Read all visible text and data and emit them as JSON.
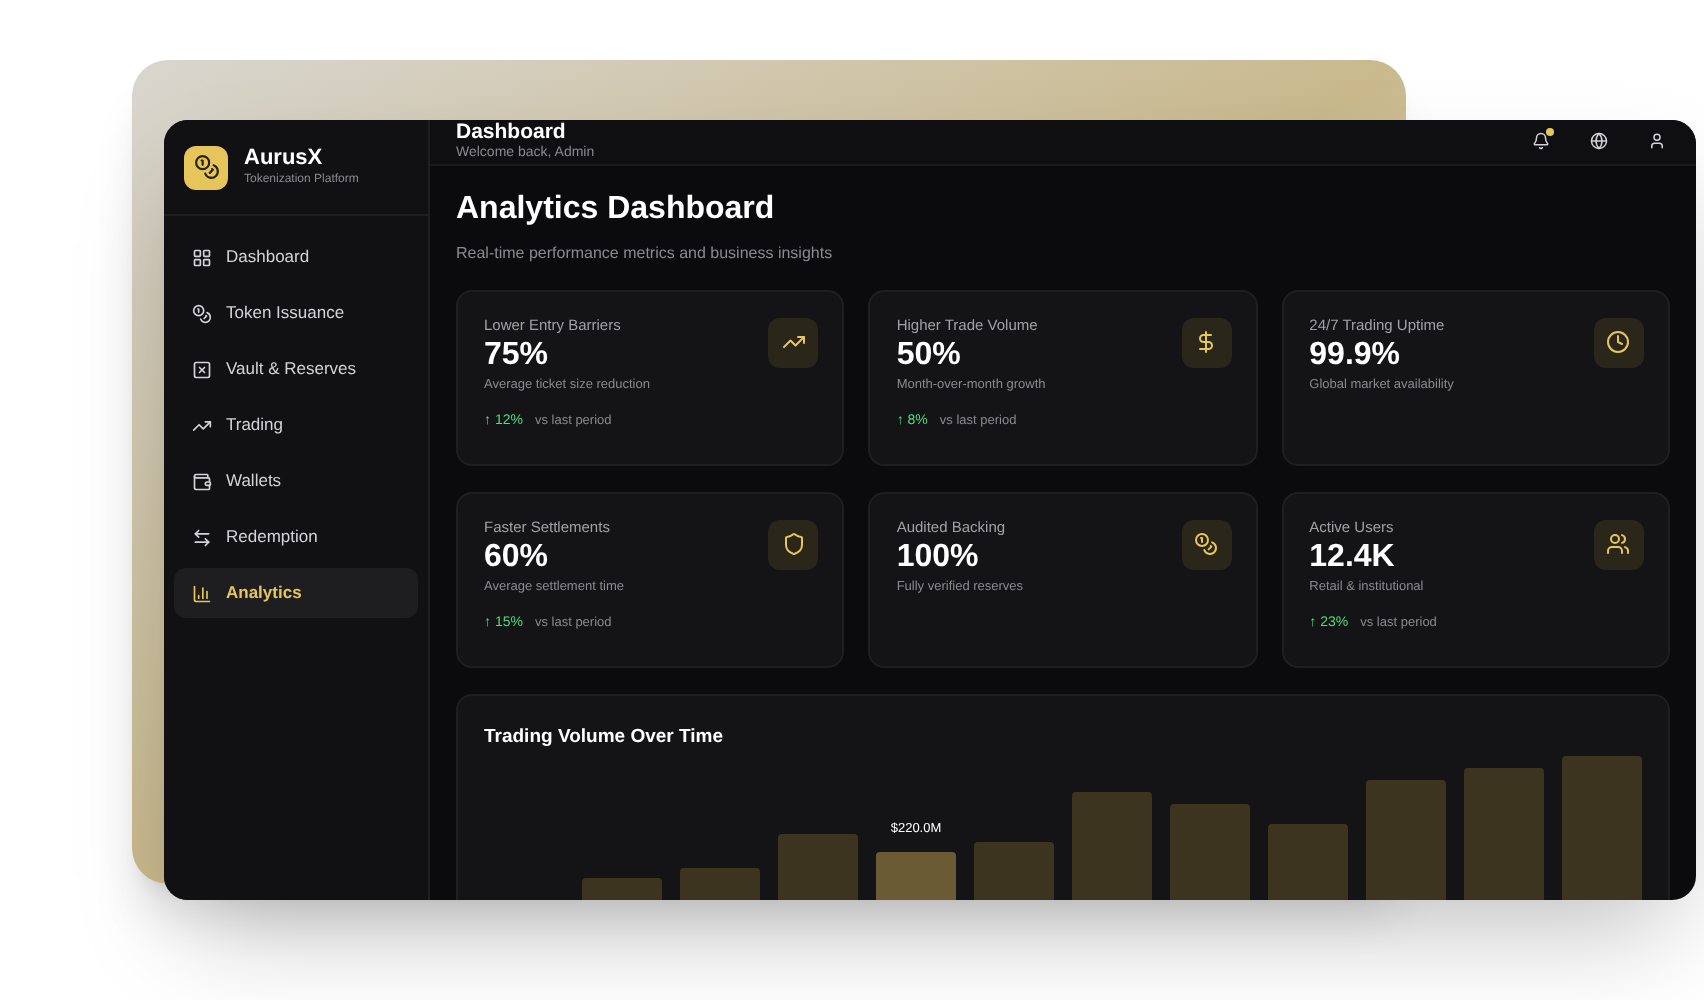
{
  "brand": {
    "name": "AurusX",
    "tagline": "Tokenization Platform"
  },
  "sidebar": {
    "items": [
      {
        "label": "Dashboard",
        "selected": false
      },
      {
        "label": "Token Issuance",
        "selected": false
      },
      {
        "label": "Vault & Reserves",
        "selected": false
      },
      {
        "label": "Trading",
        "selected": false
      },
      {
        "label": "Wallets",
        "selected": false
      },
      {
        "label": "Redemption",
        "selected": false
      },
      {
        "label": "Analytics",
        "selected": true
      }
    ]
  },
  "header": {
    "title": "Dashboard",
    "subtitle": "Welcome back, Admin",
    "notifications_unread": true
  },
  "page": {
    "title": "Analytics Dashboard",
    "subtitle": "Real-time performance metrics and business insights"
  },
  "cards": [
    {
      "title": "Lower Entry Barriers",
      "value": "75%",
      "caption": "Average ticket size reduction",
      "trend": "↑ 12%",
      "trend_note": "vs last period"
    },
    {
      "title": "Higher Trade Volume",
      "value": "50%",
      "caption": "Month-over-month growth",
      "trend": "↑ 8%",
      "trend_note": "vs last period"
    },
    {
      "title": "24/7 Trading Uptime",
      "value": "99.9%",
      "caption": "Global market availability"
    },
    {
      "title": "Faster Settlements",
      "value": "60%",
      "caption": "Average settlement time",
      "trend": "↑ 15%",
      "trend_note": "vs last period"
    },
    {
      "title": "Audited Backing",
      "value": "100%",
      "caption": "Fully verified reserves"
    },
    {
      "title": "Active Users",
      "value": "12.4K",
      "caption": "Retail & institutional",
      "trend": "↑ 23%",
      "trend_note": "vs last period"
    }
  ],
  "chart": {
    "title": "Trading Volume Over Time",
    "tooltip": "$220.0M"
  }
}
